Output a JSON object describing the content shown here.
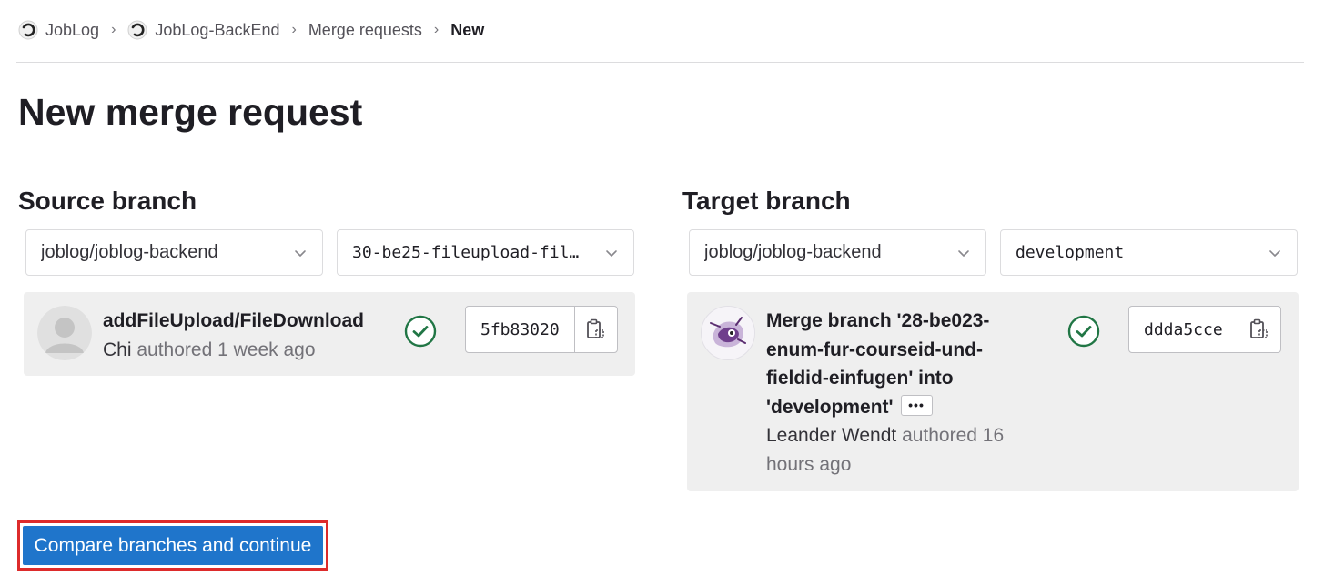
{
  "breadcrumb": {
    "items": [
      {
        "label": "JobLog"
      },
      {
        "label": "JobLog-BackEnd"
      },
      {
        "label": "Merge requests"
      },
      {
        "label": "New"
      }
    ],
    "separator": "›"
  },
  "page_title": "New merge request",
  "source": {
    "title": "Source branch",
    "project": "joblog/joblog-backend",
    "branch": "30-be25-fileupload-fil…",
    "commit": {
      "title": "addFileUpload/FileDownload",
      "author": "Chi",
      "authored_text": "authored 1 week ago",
      "sha": "5fb83020",
      "status": "success"
    }
  },
  "target": {
    "title": "Target branch",
    "project": "joblog/joblog-backend",
    "branch": "development",
    "commit": {
      "title_lines": [
        "Merge branch '28-be023-",
        "enum-fur-courseid-und-",
        "fieldid-einfugen' into",
        "'development'"
      ],
      "author": "Leander Wendt",
      "authored_text_line1": "authored 16",
      "authored_text_line2": "hours ago",
      "sha": "ddda5cce",
      "status": "success",
      "ellipsis": "•••"
    }
  },
  "cta_label": "Compare branches and continue",
  "colors": {
    "primary": "#1f75cb",
    "success": "#217645",
    "highlight": "#dd2b2b"
  }
}
